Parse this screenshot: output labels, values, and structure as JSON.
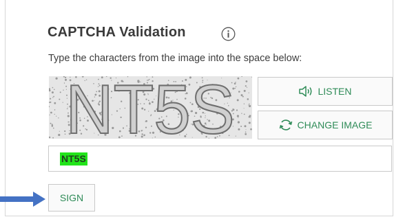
{
  "captcha": {
    "title": "CAPTCHA Validation",
    "info_icon": "info-circle-icon",
    "instruction": "Type the characters from the image into the space below:",
    "image_text": "NT5S",
    "listen_label": "LISTEN",
    "listen_icon": "speaker-icon",
    "change_image_label": "CHANGE IMAGE",
    "change_image_icon": "refresh-icon",
    "answer_value": "NT5S",
    "sign_label": "SIGN"
  },
  "colors": {
    "accent_text": "#2e8b57",
    "highlight": "#22e41a",
    "arrow": "#4472c4"
  }
}
